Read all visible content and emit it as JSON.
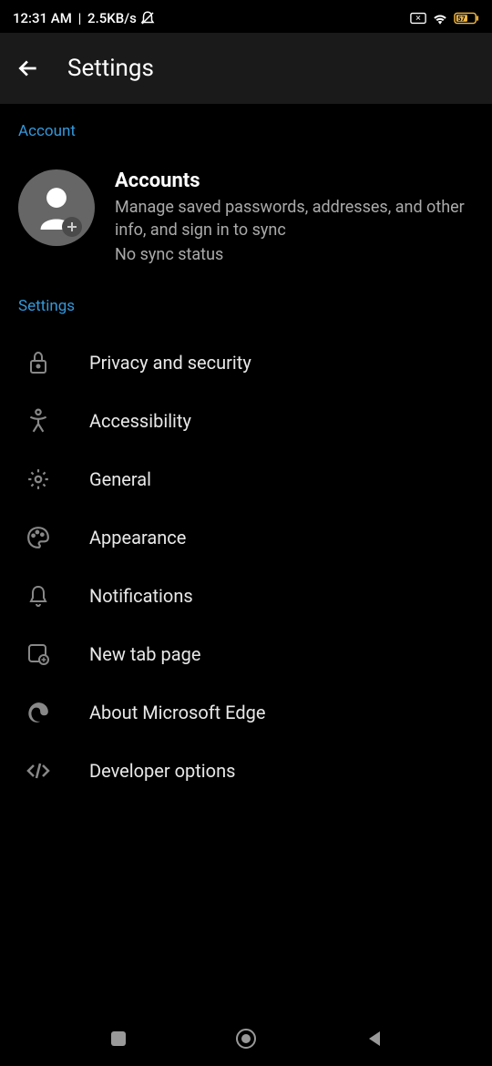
{
  "statusBar": {
    "time": "12:31 AM",
    "speed": "2.5KB/s",
    "battery": "57"
  },
  "header": {
    "title": "Settings"
  },
  "sections": {
    "account": {
      "header": "Account",
      "title": "Accounts",
      "description": "Manage saved passwords, addresses, and other info, and sign in to sync",
      "syncStatus": "No sync status"
    },
    "settings": {
      "header": "Settings",
      "items": [
        {
          "label": "Privacy and security"
        },
        {
          "label": "Accessibility"
        },
        {
          "label": "General"
        },
        {
          "label": "Appearance"
        },
        {
          "label": "Notifications"
        },
        {
          "label": "New tab page"
        },
        {
          "label": "About Microsoft Edge"
        },
        {
          "label": "Developer options"
        }
      ]
    }
  }
}
